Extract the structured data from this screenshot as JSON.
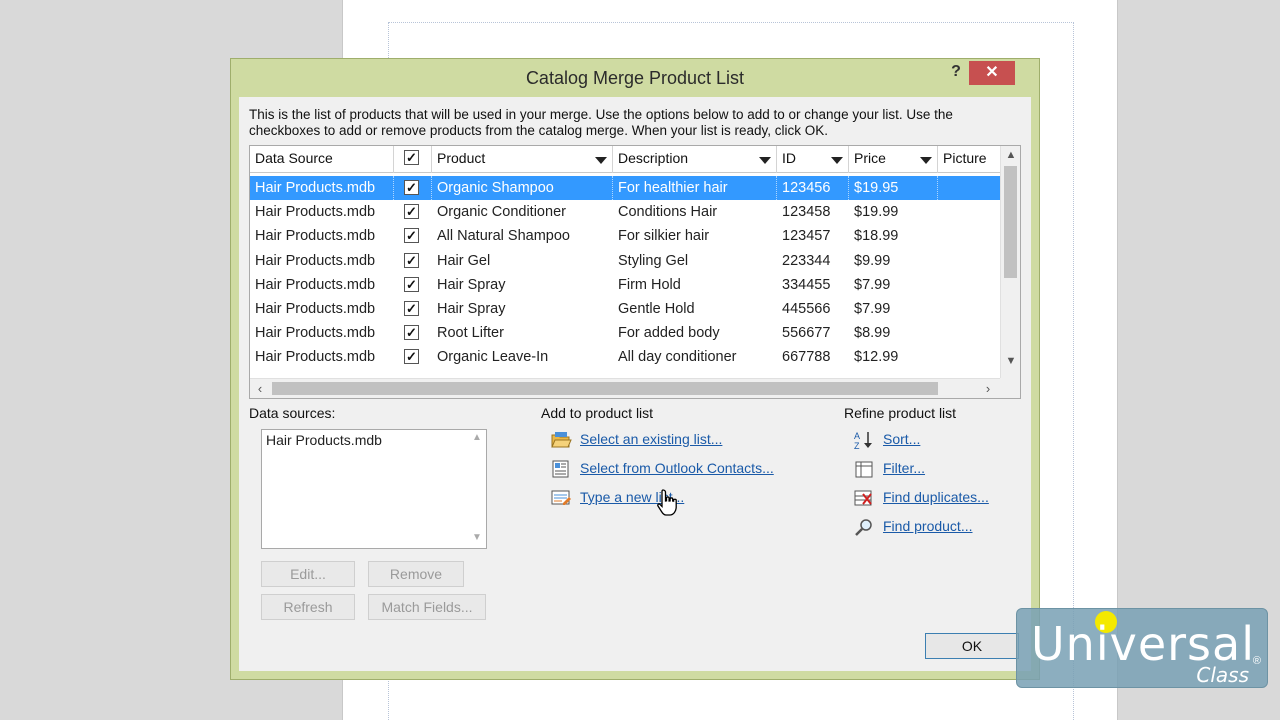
{
  "dialog": {
    "title": "Catalog Merge Product List",
    "help": "?",
    "close": "✕",
    "intro": "This is the list of products that will be used in your merge.  Use the options below to add to or change your list.  Use the checkboxes to add or remove products from the catalog merge.  When your list is ready, click OK."
  },
  "grid": {
    "headers": {
      "source": "Data Source",
      "product": "Product",
      "description": "Description",
      "id": "ID",
      "price": "Price",
      "picture": "Picture"
    },
    "rows": [
      {
        "source": "Hair Products.mdb",
        "checked": "✓",
        "product": "Organic Shampoo",
        "description": "For healthier hair",
        "id": "123456",
        "price": "$19.95"
      },
      {
        "source": "Hair Products.mdb",
        "checked": "✓",
        "product": "Organic Conditioner",
        "description": "Conditions Hair",
        "id": "123458",
        "price": "$19.99"
      },
      {
        "source": "Hair Products.mdb",
        "checked": "✓",
        "product": "All Natural Shampoo",
        "description": "For silkier hair",
        "id": "123457",
        "price": "$18.99"
      },
      {
        "source": "Hair Products.mdb",
        "checked": "✓",
        "product": "Hair Gel",
        "description": "Styling Gel",
        "id": "223344",
        "price": "$9.99"
      },
      {
        "source": "Hair Products.mdb",
        "checked": "✓",
        "product": "Hair Spray",
        "description": "Firm Hold",
        "id": "334455",
        "price": "$7.99"
      },
      {
        "source": "Hair Products.mdb",
        "checked": "✓",
        "product": "Hair Spray",
        "description": "Gentle Hold",
        "id": "445566",
        "price": "$7.99"
      },
      {
        "source": "Hair Products.mdb",
        "checked": "✓",
        "product": "Root Lifter",
        "description": "For added body",
        "id": "556677",
        "price": "$8.99"
      },
      {
        "source": "Hair Products.mdb",
        "checked": "✓",
        "product": "Organic Leave-In",
        "description": "All day conditioner",
        "id": "667788",
        "price": "$12.99"
      }
    ]
  },
  "data_sources": {
    "label": "Data sources:",
    "items": [
      "Hair Products.mdb"
    ],
    "buttons": {
      "edit": "Edit...",
      "remove": "Remove",
      "refresh": "Refresh",
      "match": "Match Fields..."
    }
  },
  "add_list": {
    "label": "Add to product list",
    "links": [
      {
        "text": "Select an existing list...",
        "icon": "folder-open-icon"
      },
      {
        "text": "Select from Outlook Contacts...",
        "icon": "contacts-icon"
      },
      {
        "text": "Type a new list...",
        "icon": "new-list-icon"
      }
    ]
  },
  "refine": {
    "label": "Refine product list",
    "links": [
      {
        "text": "Sort...",
        "icon": "sort-az-icon"
      },
      {
        "text": "Filter...",
        "icon": "filter-icon"
      },
      {
        "text": "Find duplicates...",
        "icon": "find-duplicates-icon"
      },
      {
        "text": "Find product...",
        "icon": "find-product-icon"
      }
    ]
  },
  "ok": "OK",
  "logo": {
    "main": "Universal",
    "sub": "Class",
    "reg": "®"
  },
  "colors": {
    "selection": "#3399ff",
    "link": "#1a5aa8",
    "dialog_frame": "#cfdba2",
    "close": "#c75050"
  }
}
